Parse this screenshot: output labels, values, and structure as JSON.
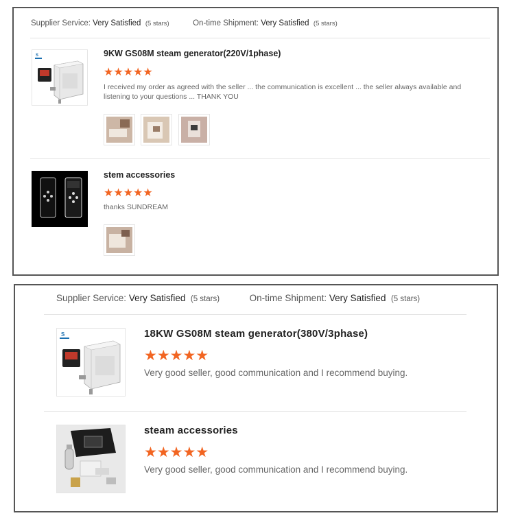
{
  "panel1": {
    "summary": {
      "supplier_label": "Supplier Service:",
      "supplier_value": "Very Satisfied",
      "supplier_count": "(5 stars)",
      "shipment_label": "On-time Shipment:",
      "shipment_value": "Very Satisfied",
      "shipment_count": "(5 stars)"
    },
    "reviews": [
      {
        "product": "9KW GS08M steam generator(220V/1phase)",
        "stars": "★★★★★",
        "text": "I received my order as agreed with the seller ... the communication is excellent ... the seller always available and listening to your questions ... THANK YOU",
        "photo_count": 3
      },
      {
        "product": "stem accessories",
        "stars": "★★★★★",
        "text": "thanks SUNDREAM",
        "photo_count": 1
      }
    ]
  },
  "panel2": {
    "summary": {
      "supplier_label": "Supplier Service:",
      "supplier_value": "Very Satisfied",
      "supplier_count": "(5 stars)",
      "shipment_label": "On-time Shipment:",
      "shipment_value": "Very Satisfied",
      "shipment_count": "(5 stars)"
    },
    "reviews": [
      {
        "product": "18KW GS08M steam generator(380V/3phase)",
        "stars": "★★★★★",
        "text": "Very good seller, good communication and I recommend buying."
      },
      {
        "product": "steam accessories",
        "stars": "★★★★★",
        "text": "Very good seller, good communication and I recommend buying."
      }
    ]
  },
  "colors": {
    "star": "#f26522",
    "border": "#555555",
    "divider": "#e3e3e3"
  },
  "rating": {
    "stars_filled": 5,
    "stars_max": 5
  }
}
